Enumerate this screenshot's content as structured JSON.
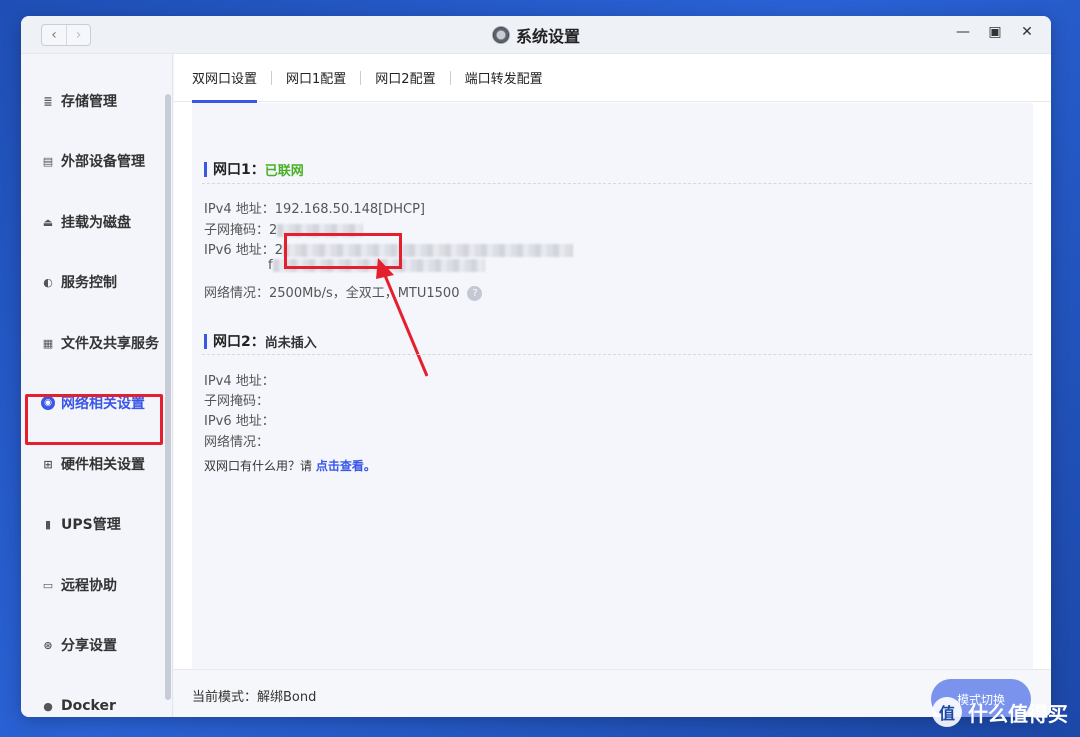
{
  "window": {
    "title": "系统设置",
    "controls": [
      "minimize",
      "maximize",
      "close"
    ]
  },
  "nav": {
    "back_icon": "chevron-left-icon",
    "forward_icon": "chevron-right-icon"
  },
  "sidebar": {
    "items": [
      {
        "label": "存储管理",
        "icon": "database-icon"
      },
      {
        "label": "外部设备管理",
        "icon": "device-icon"
      },
      {
        "label": "挂载为磁盘",
        "icon": "disk-icon"
      },
      {
        "label": "服务控制",
        "icon": "toggle-icon"
      },
      {
        "label": "文件及共享服务",
        "icon": "file-share-icon"
      },
      {
        "label": "网络相关设置",
        "icon": "globe-icon",
        "active": true
      },
      {
        "label": "硬件相关设置",
        "icon": "grid-icon"
      },
      {
        "label": "UPS管理",
        "icon": "ups-icon"
      },
      {
        "label": "远程协助",
        "icon": "monitor-icon"
      },
      {
        "label": "分享设置",
        "icon": "share-icon"
      },
      {
        "label": "Docker",
        "icon": "docker-icon"
      }
    ]
  },
  "tabs": [
    {
      "label": "双网口设置",
      "active": true
    },
    {
      "label": "网口1配置"
    },
    {
      "label": "网口2配置"
    },
    {
      "label": "端口转发配置"
    }
  ],
  "port1": {
    "title": "网口1：",
    "status": "已联网",
    "ipv4_label": "IPv4 地址：",
    "ipv4_value": "192.168.50.148[DHCP]",
    "mask_label": "子网掩码：",
    "mask_prefix": "2",
    "ipv6_label": "IPv6 地址：",
    "ipv6_prefix": "2",
    "ipv6_line2_prefix": "f",
    "net_label": "网络情况：",
    "net_value": "2500Mb/s，全双工，MTU1500"
  },
  "port2": {
    "title": "网口2：",
    "status": "尚未插入",
    "ipv4_label": "IPv4 地址：",
    "mask_label": "子网掩码：",
    "ipv6_label": "IPv6 地址：",
    "net_label": "网络情况："
  },
  "help": {
    "question": "双网口有什么用？请 ",
    "link": "点击查看。"
  },
  "footer": {
    "mode_text": "当前模式：解绑Bond",
    "switch_button": "模式切换"
  },
  "watermark": {
    "text": "什么值得买",
    "logo": "值"
  },
  "colors": {
    "accent": "#3a57e8",
    "ok": "#47b024",
    "annotation": "#e5202e"
  }
}
